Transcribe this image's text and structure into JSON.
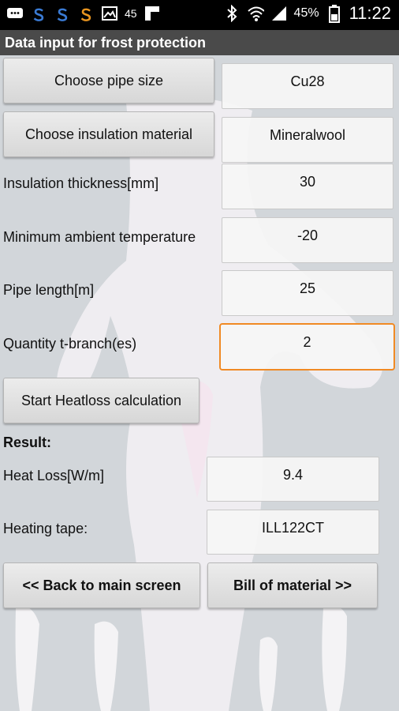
{
  "status": {
    "battery_left": "45",
    "battery_right": "45%",
    "time": "11:22"
  },
  "title": "Data input for frost protection",
  "rows": {
    "pipe_size": {
      "button": "Choose pipe size",
      "value": "Cu28"
    },
    "insulation_material": {
      "button": "Choose insulation material",
      "value": "Mineralwool"
    },
    "insulation_thickness": {
      "label": "Insulation thickness[mm]",
      "value": "30"
    },
    "min_ambient_temp": {
      "label": "Minimum ambient temperature",
      "value": "-20"
    },
    "pipe_length": {
      "label": "Pipe length[m]",
      "value": "25"
    },
    "t_branches": {
      "label": "Quantity t-branch(es)",
      "value": "2"
    }
  },
  "start_button": "Start Heatloss calculation",
  "result": {
    "heading": "Result:",
    "heat_loss_label": "Heat Loss[W/m]",
    "heat_loss_value": "9.4",
    "heating_tape_label": "Heating tape:",
    "heating_tape_value": "ILL122CT"
  },
  "nav": {
    "back": "<< Back to main screen",
    "bom": "Bill of material >>"
  }
}
